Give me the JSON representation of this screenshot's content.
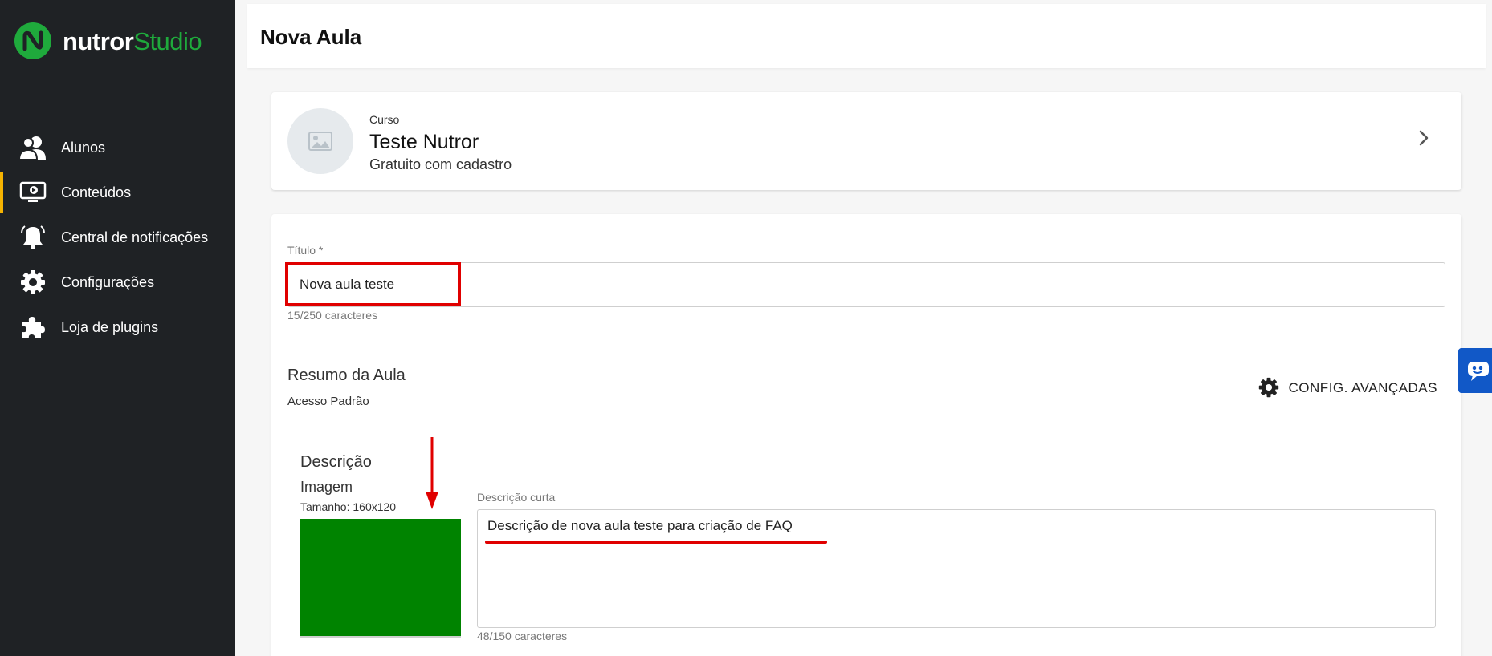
{
  "brand": {
    "name_part1": "nutror",
    "name_part2": "Studio",
    "accent": "#1faa3c"
  },
  "sidebar": {
    "items": [
      {
        "label": "Alunos",
        "icon": "users-icon",
        "active": false
      },
      {
        "label": "Conteúdos",
        "icon": "monitor-play-icon",
        "active": true
      },
      {
        "label": "Central de notificações",
        "icon": "bell-icon",
        "active": false
      },
      {
        "label": "Configurações",
        "icon": "gear-icon",
        "active": false
      },
      {
        "label": "Loja de plugins",
        "icon": "puzzle-icon",
        "active": false
      }
    ],
    "active_color": "#f5b301"
  },
  "header": {
    "title": "Nova Aula"
  },
  "course": {
    "kicker": "Curso",
    "name": "Teste Nutror",
    "subtitle": "Gratuito com cadastro"
  },
  "form": {
    "title_label": "Título *",
    "title_value": "Nova aula teste",
    "title_count": "15/250 caracteres",
    "summary_title": "Resumo da Aula",
    "summary_sub": "Acesso Padrão",
    "advanced_label": "CONFIG. AVANÇADAS",
    "description_title": "Descrição",
    "image_title": "Imagem",
    "image_size": "Tamanho: 160x120",
    "image_color": "#008300",
    "short_desc_label": "Descrição curta",
    "short_desc_value": "Descrição de nova aula teste para criação de FAQ",
    "short_desc_count": "48/150 caracteres"
  },
  "annotations": {
    "color": "#e00000"
  },
  "chat": {
    "icon": "chat-bubble-icon",
    "color": "#1158c7"
  }
}
